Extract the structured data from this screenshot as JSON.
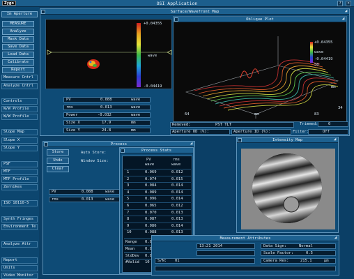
{
  "app": {
    "title": "OSI Application",
    "logo": "Zygo"
  },
  "sidebar": {
    "items": [
      "Im Aperture",
      "MEASURE",
      "Analyze",
      "Mask Data",
      "Save Data",
      "Load Data",
      "Calibrate",
      "Report",
      "Measure Cntrl",
      "Analyze Cntrl",
      "Controls",
      "W/W Profile",
      "W/W Profile",
      "Slope Map",
      "Slope X",
      "Slope Y",
      "PSF",
      "MTF",
      "MTF Profile",
      "Zernikes",
      "ISO 10110-5",
      "Synth Fringes",
      "Environment Te",
      "Analyze Attr",
      "Report",
      "Units",
      "Video Monitor"
    ]
  },
  "surface_map": {
    "title": "Surface/Wavefront Map",
    "colorbar_max": "+0.04355",
    "colorbar_min": "-0.04419",
    "colorbar_unit": "wave",
    "stats": [
      {
        "label": "PV",
        "value": "0.088",
        "unit": "wave"
      },
      {
        "label": "rms",
        "value": "0.013",
        "unit": "wave"
      },
      {
        "label": "Power",
        "value": "-0.032",
        "unit": "wave"
      },
      {
        "label": "Size X",
        "value": "17.9",
        "unit": "mm"
      },
      {
        "label": "Size Y",
        "value": "24.8",
        "unit": "mm"
      }
    ]
  },
  "oblique_plot": {
    "title": "Oblique Plot",
    "max": "+0.04355",
    "unit": "wave",
    "min": "-0.04419",
    "axis_z": "50",
    "axis_y_unit": "mm",
    "axis_y_tick": "34",
    "axis_x_left": "64",
    "axis_x_unit": "mm",
    "axis_x_right": "83"
  },
  "removed": {
    "removed_label": "Removed:",
    "removed_value": "PST TLT",
    "trimmed_label": "Trimmed:",
    "trimmed_value": "0",
    "ap_od_label": "Aperture OD (%):",
    "ap_id_label": "Aperture ID (%):",
    "filter_label": "Filter:",
    "filter_value": "Off"
  },
  "process": {
    "title": "Process",
    "store": "Store",
    "undo": "Undo",
    "clear": "Clear",
    "auto_store": "Auto Store:",
    "window_size": "Window Size:",
    "stats": [
      {
        "label": "PV",
        "value": "0.088",
        "unit": "wave"
      },
      {
        "label": "rms",
        "value": "0.013",
        "unit": "wave"
      }
    ]
  },
  "process_stats": {
    "title": "Process Stats",
    "col_pv": "PV",
    "col_pv_unit": "wave",
    "col_rms": "rms",
    "col_rms_unit": "wave",
    "rows": [
      {
        "n": "1",
        "pv": "0.069",
        "rms": "0.012"
      },
      {
        "n": "2",
        "pv": "0.074",
        "rms": "0.015"
      },
      {
        "n": "3",
        "pv": "0.084",
        "rms": "0.014"
      },
      {
        "n": "4",
        "pv": "0.089",
        "rms": "0.014"
      },
      {
        "n": "5",
        "pv": "0.096",
        "rms": "0.014"
      },
      {
        "n": "6",
        "pv": "0.065",
        "rms": "0.012"
      },
      {
        "n": "7",
        "pv": "0.070",
        "rms": "0.013"
      },
      {
        "n": "8",
        "pv": "0.087",
        "rms": "0.013"
      },
      {
        "n": "9",
        "pv": "0.086",
        "rms": "0.014"
      },
      {
        "n": "10",
        "pv": "0.088",
        "rms": "0.013"
      }
    ],
    "summary": [
      {
        "label": "Range",
        "pv": "0.031",
        "rms": "0.003"
      },
      {
        "label": "Mean",
        "pv": "0.081",
        "rms": "0.013"
      },
      {
        "label": "StdDev",
        "pv": "0.011",
        "rms": "0.001"
      },
      {
        "label": "#Valid",
        "pv": "10",
        "rms": "10"
      }
    ]
  },
  "intensity": {
    "title": "Intensity Map"
  },
  "attributes": {
    "title": "Measurement Attributes",
    "date": "13:21 2014",
    "sn_label": "S/N:",
    "sn_value": "01",
    "data_sign_label": "Data Sign:",
    "data_sign_value": "Normal",
    "scale_factor_label": "Scale Factor:",
    "scale_factor_value": "0.5",
    "camera_res_label": "Camera Res:",
    "camera_res_value": "215.1",
    "camera_res_unit": "µm"
  },
  "colors": {
    "background": "#0b3f66",
    "panel": "#0e4b76",
    "title": "#1d6190",
    "field": "#061d30",
    "accent": "#5e93b9"
  }
}
